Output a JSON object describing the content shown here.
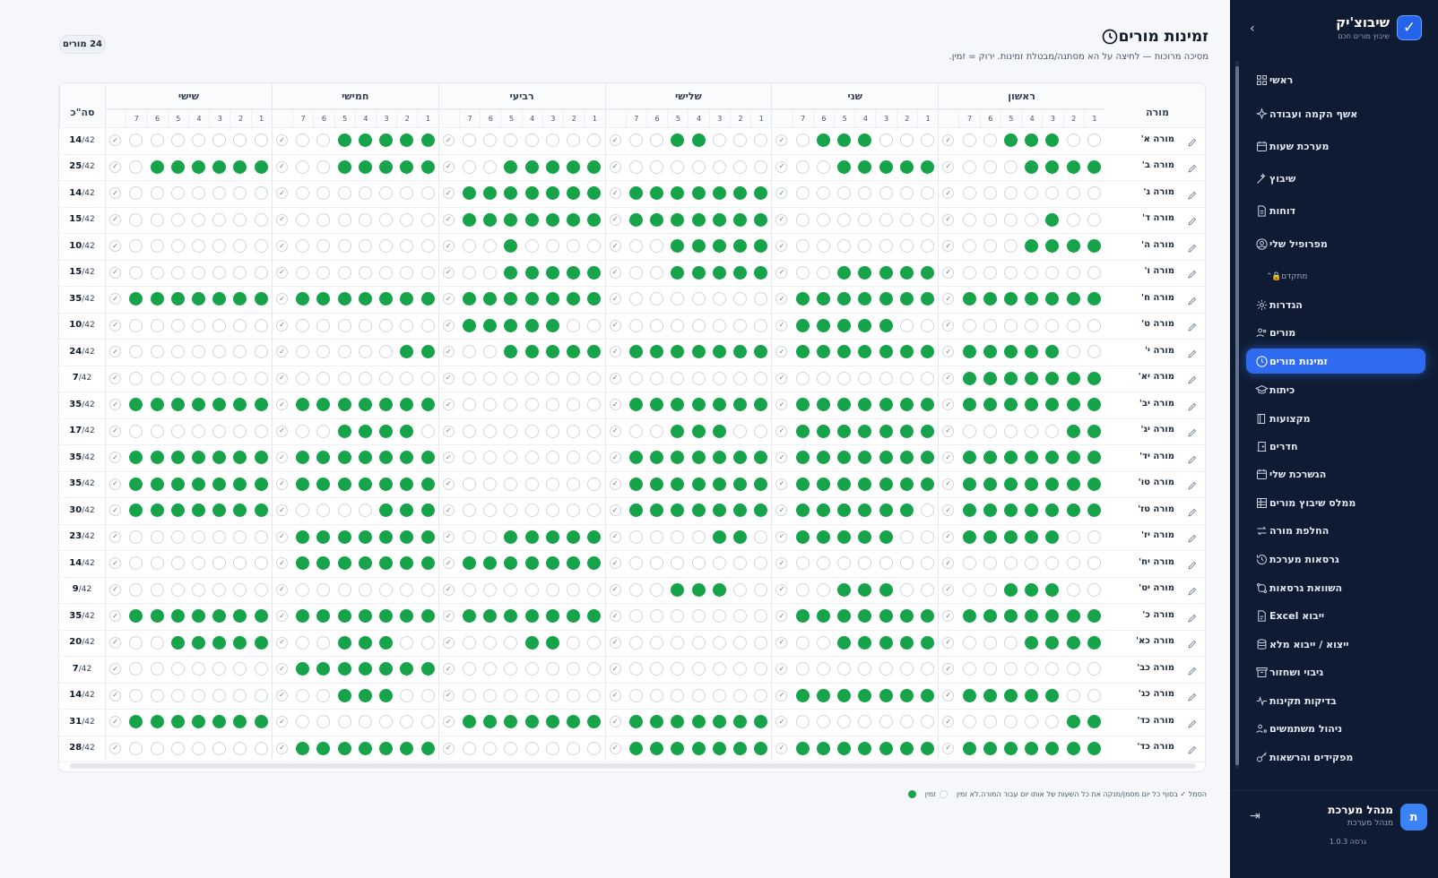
{
  "sidebar": {
    "brand_name": "שיבוצ'יק",
    "brand_sub": "שיבוץ מורים חכם",
    "section_label": "מתקדם",
    "items": [
      {
        "label": "ראשי",
        "icon": "grid-icon"
      },
      {
        "label": "אשף הקמה ועבודה",
        "icon": "sparkle-icon"
      },
      {
        "label": "מערכת שעות",
        "icon": "calendar-icon"
      },
      {
        "label": "שיבוץ",
        "icon": "wand-icon"
      },
      {
        "label": "דוחות",
        "icon": "document-icon"
      },
      {
        "label": "מפרופיל שלי",
        "icon": "profile-icon"
      },
      {
        "label": "הגדרות",
        "icon": "gear-icon"
      },
      {
        "label": "מורים",
        "icon": "users-icon"
      },
      {
        "label": "זמינות מורים",
        "icon": "clock-icon",
        "active": true
      },
      {
        "label": "כיתות",
        "icon": "cap-icon"
      },
      {
        "label": "מקצועות",
        "icon": "book-icon"
      },
      {
        "label": "חדרים",
        "icon": "door-icon"
      },
      {
        "label": "הגשרכת שלי",
        "icon": "calendar-icon"
      },
      {
        "label": "ממלס שיבוץ מורים",
        "icon": "table-icon"
      },
      {
        "label": "החלפת מורה",
        "icon": "swap-icon"
      },
      {
        "label": "גרסאות מערכת",
        "icon": "history-icon"
      },
      {
        "label": "השוואת גרסאות",
        "icon": "compare-icon"
      },
      {
        "label": "ייבוא Excel",
        "icon": "file-icon"
      },
      {
        "label": "ייצוא / ייבוא מלא",
        "icon": "database-icon"
      },
      {
        "label": "גיבוי ושחזור",
        "icon": "archive-icon"
      },
      {
        "label": "בדיקות תקינות",
        "icon": "pulse-icon"
      },
      {
        "label": "ניהול משתמשים",
        "icon": "user-gear-icon"
      },
      {
        "label": "מפקידים והרשאות",
        "icon": "key-icon"
      }
    ],
    "user": {
      "initial": "ת",
      "name": "מנהל מערכת",
      "role": "מנהל מערכת",
      "version": "גרסה 1.0.3"
    }
  },
  "header": {
    "title": "זמינות מורים",
    "subtitle": "מסיכה מרוכות — לחיצה על הא מסתנה/מבטלת זמינות. ירוק = זמין.",
    "count_badge": "24 מורים"
  },
  "table": {
    "teacher_col": "מורה",
    "total_col": "סה\"כ",
    "days": [
      "ראשון",
      "שני",
      "שלישי",
      "רביעי",
      "חמישי",
      "שישי"
    ],
    "periods": [
      "1",
      "2",
      "3",
      "4",
      "5",
      "6",
      "7"
    ],
    "max_hours": 42,
    "rows": [
      {
        "name": "מורה א'",
        "total": "14",
        "a": [
          "0011100",
          "0001110",
          "0001100",
          "0000000",
          "1111100",
          "0000000"
        ]
      },
      {
        "name": "מורה ב'",
        "total": "25",
        "a": [
          "1111000",
          "1111100",
          "0000000",
          "1111100",
          "1111100",
          "1111110"
        ]
      },
      {
        "name": "מורה ג'",
        "total": "14",
        "a": [
          "0000000",
          "0000000",
          "1111111",
          "1111111",
          "0000000",
          "0000000"
        ]
      },
      {
        "name": "מורה ד'",
        "total": "15",
        "a": [
          "0010000",
          "0000000",
          "1111111",
          "1111111",
          "0000000",
          "0000000"
        ]
      },
      {
        "name": "מורה ה'",
        "total": "10",
        "a": [
          "1111000",
          "0000000",
          "1111100",
          "0000100",
          "0000000",
          "0000000"
        ]
      },
      {
        "name": "מורה ו'",
        "total": "15",
        "a": [
          "0000000",
          "1111100",
          "1111100",
          "1111100",
          "0000000",
          "0000000"
        ]
      },
      {
        "name": "מורה ח'",
        "total": "35",
        "a": [
          "1111111",
          "1111111",
          "0000000",
          "1111111",
          "1111111",
          "1111111"
        ]
      },
      {
        "name": "מורה ט'",
        "total": "10",
        "a": [
          "0000000",
          "0011111",
          "0000000",
          "0011111",
          "0000000",
          "0000000"
        ]
      },
      {
        "name": "מורה י'",
        "total": "24",
        "a": [
          "0011111",
          "1111111",
          "1111111",
          "1111100",
          "1100000",
          "0000000"
        ]
      },
      {
        "name": "מורה יא'",
        "total": "7",
        "a": [
          "1111111",
          "0000000",
          "0000000",
          "0000000",
          "0000000",
          "0000000"
        ]
      },
      {
        "name": "מורה יב'",
        "total": "35",
        "a": [
          "1111111",
          "1111111",
          "1111111",
          "0000000",
          "1111111",
          "1111111"
        ]
      },
      {
        "name": "מורה יג'",
        "total": "17",
        "a": [
          "1100000",
          "1111111",
          "0011100",
          "0000000",
          "0111100",
          "0000000"
        ]
      },
      {
        "name": "מורה יד'",
        "total": "35",
        "a": [
          "1111111",
          "1111111",
          "1111111",
          "0000000",
          "1111111",
          "1111111"
        ]
      },
      {
        "name": "מורה טו'",
        "total": "35",
        "a": [
          "1111111",
          "1111111",
          "1111111",
          "0000000",
          "1111111",
          "1111111"
        ]
      },
      {
        "name": "מורה טז'",
        "total": "30",
        "a": [
          "1111111",
          "0111111",
          "1111111",
          "0000000",
          "1110000",
          "1111111"
        ]
      },
      {
        "name": "מורה יז'",
        "total": "23",
        "a": [
          "0011111",
          "0011111",
          "0110000",
          "1111100",
          "1111111",
          "0000000"
        ]
      },
      {
        "name": "מורה יח'",
        "total": "14",
        "a": [
          "0000000",
          "0000000",
          "0000000",
          "1111111",
          "1111111",
          "0000000"
        ]
      },
      {
        "name": "מורה יט'",
        "total": "9",
        "a": [
          "0011100",
          "0011100",
          "0011100",
          "0000000",
          "0000000",
          "0000000"
        ]
      },
      {
        "name": "מורה כ'",
        "total": "35",
        "a": [
          "1111111",
          "1111111",
          "0000000",
          "1111111",
          "1111111",
          "1111111"
        ]
      },
      {
        "name": "מורה כא'",
        "total": "20",
        "a": [
          "1111000",
          "1111100",
          "0000000",
          "0011000",
          "0011100",
          "1111100"
        ]
      },
      {
        "name": "מורה כב'",
        "total": "7",
        "a": [
          "0000000",
          "0000000",
          "0000000",
          "0000000",
          "1111111",
          "0000000"
        ]
      },
      {
        "name": "מורה כג'",
        "total": "14",
        "a": [
          "0011111",
          "1111111",
          "0000000",
          "0000000",
          "0011100",
          "0000000"
        ]
      },
      {
        "name": "מורה כד'",
        "total": "31",
        "a": [
          "1100000",
          "0000000",
          "1111111",
          "1111111",
          "0000000",
          "1111111"
        ]
      },
      {
        "name": "מורה כד'",
        "total": "28",
        "a": [
          "1111111",
          "1111111",
          "1111111",
          "0000000",
          "1111111",
          "0000000"
        ]
      }
    ]
  },
  "legend": {
    "available": "זמין",
    "unavailable": "לא זמין",
    "note": "הסמל ✓ בסוף כל יום מסמן/מנקה את כל השעות של אותו יום עבור המורה."
  },
  "colors": {
    "accent": "#2f6bf0",
    "available": "#16a34a",
    "sidebar_bg": "#0f1b33"
  }
}
